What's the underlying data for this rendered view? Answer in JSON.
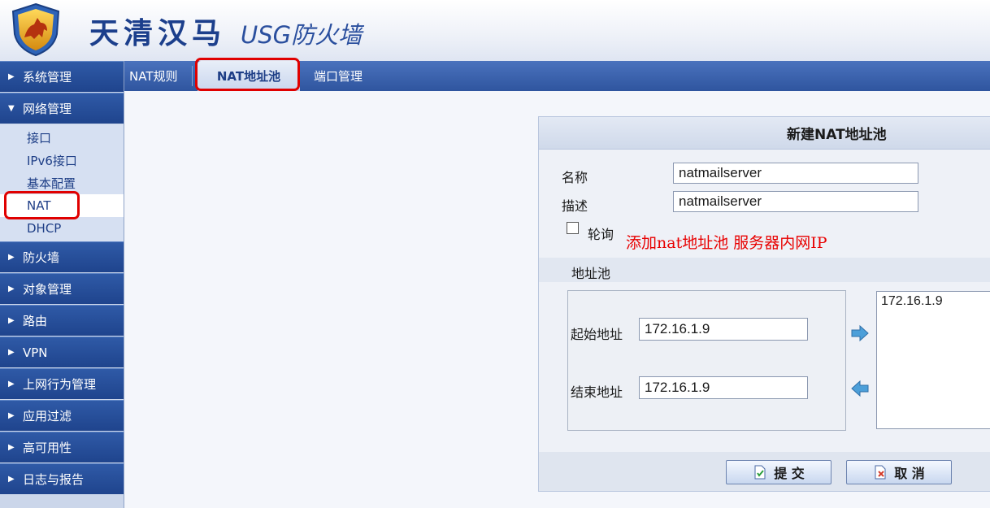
{
  "header": {
    "brand": "天清汉马",
    "product": "USG防火墙"
  },
  "sidebar": {
    "menus": [
      {
        "label": "系统管理",
        "expanded": false
      },
      {
        "label": "网络管理",
        "expanded": true,
        "children": [
          "接口",
          "IPv6接口",
          "基本配置",
          "NAT",
          "DHCP"
        ],
        "active_child": "NAT"
      },
      {
        "label": "防火墙",
        "expanded": false
      },
      {
        "label": "对象管理",
        "expanded": false
      },
      {
        "label": "路由",
        "expanded": false
      },
      {
        "label": "VPN",
        "expanded": false
      },
      {
        "label": "上网行为管理",
        "expanded": false
      },
      {
        "label": "应用过滤",
        "expanded": false
      },
      {
        "label": "高可用性",
        "expanded": false
      },
      {
        "label": "日志与报告",
        "expanded": false
      }
    ]
  },
  "tabs": {
    "items": [
      "NAT规则",
      "NAT地址池",
      "端口管理"
    ],
    "active": "NAT地址池"
  },
  "form": {
    "title": "新建NAT地址池",
    "name_label": "名称",
    "name_value": "natmailserver",
    "desc_label": "描述",
    "desc_value": "natmailserver",
    "polling_label": "轮询",
    "polling_checked": false,
    "pool_section_label": "地址池",
    "start_label": "起始地址",
    "start_value": "172.16.1.9",
    "end_label": "结束地址",
    "end_value": "172.16.1.9",
    "pool_list": [
      "172.16.1.9"
    ],
    "submit_label": "提 交",
    "cancel_label": "取 消"
  },
  "annotation": {
    "text": "添加nat地址池  服务器内网IP",
    "color": "#e80000"
  },
  "colors": {
    "nav_blue": "#2a4f9e",
    "highlight_red": "#e00000"
  }
}
